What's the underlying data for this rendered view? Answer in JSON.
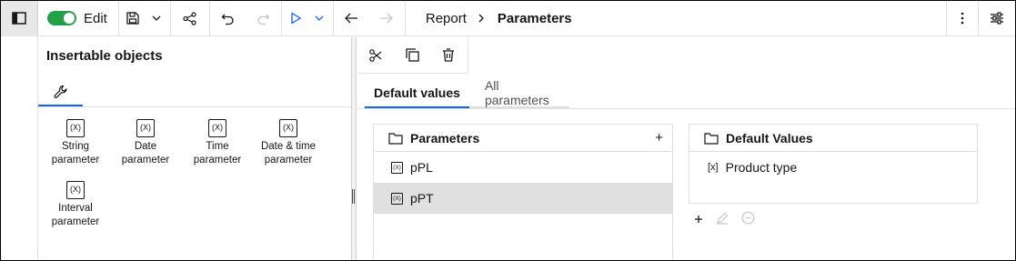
{
  "toolbar": {
    "edit_label": "Edit",
    "edit_mode_on": true,
    "breadcrumb_parent": "Report",
    "breadcrumb_current": "Parameters"
  },
  "left_panel": {
    "title": "Insertable objects",
    "objects": [
      {
        "icon": "(X)",
        "label_line1": "String",
        "label_line2": "parameter"
      },
      {
        "icon": "(X)",
        "label_line1": "Date",
        "label_line2": "parameter"
      },
      {
        "icon": "(X)",
        "label_line1": "Time",
        "label_line2": "parameter"
      },
      {
        "icon": "(X)",
        "label_line1": "Date & time",
        "label_line2": "parameter"
      },
      {
        "icon": "(X)",
        "label_line1": "Interval",
        "label_line2": "parameter"
      }
    ]
  },
  "right_panel": {
    "tabs": [
      "Default values",
      "All parameters"
    ],
    "active_tab": "Default values",
    "parameters_box": {
      "title": "Parameters",
      "add_symbol": "+",
      "items": [
        {
          "icon": "(X)",
          "name": "pPL",
          "selected": false
        },
        {
          "icon": "(X)",
          "name": "pPT",
          "selected": true
        }
      ]
    },
    "default_values_box": {
      "title": "Default Values",
      "items": [
        {
          "icon": "[x]",
          "name": "Product type"
        }
      ]
    }
  },
  "colors": {
    "accent": "#0f62fe",
    "toggle_on": "#24a148",
    "selected_row": "#e0e0e0",
    "rail_bg": "#e8e8e8"
  }
}
